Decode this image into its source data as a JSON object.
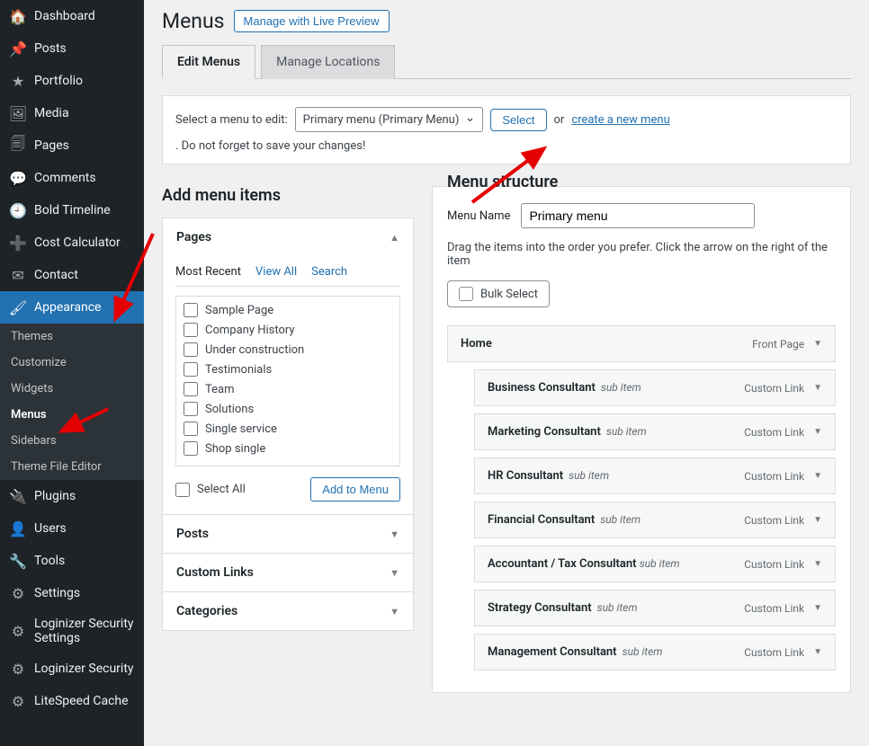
{
  "sidebar": {
    "items": [
      {
        "icon": "dashboard-icon",
        "glyph": "🏠",
        "label": "Dashboard"
      },
      {
        "icon": "posts-icon",
        "glyph": "📌",
        "label": "Posts"
      },
      {
        "icon": "portfolio-icon",
        "glyph": "★",
        "label": "Portfolio"
      },
      {
        "icon": "media-icon",
        "glyph": "🖼",
        "label": "Media"
      },
      {
        "icon": "pages-icon",
        "glyph": "🗐",
        "label": "Pages"
      },
      {
        "icon": "comments-icon",
        "glyph": "💬",
        "label": "Comments"
      },
      {
        "icon": "bold-timeline-icon",
        "glyph": "🕘",
        "label": "Bold Timeline"
      },
      {
        "icon": "cost-calculator-icon",
        "glyph": "➕",
        "label": "Cost Calculator"
      },
      {
        "icon": "contact-icon",
        "glyph": "✉",
        "label": "Contact"
      }
    ],
    "active": {
      "icon": "appearance-icon",
      "glyph": "🖌",
      "label": "Appearance"
    },
    "submenu": [
      "Themes",
      "Customize",
      "Widgets",
      "Menus",
      "Sidebars",
      "Theme File Editor"
    ],
    "submenu_current_index": 3,
    "items_after": [
      {
        "icon": "plugins-icon",
        "glyph": "🔌",
        "label": "Plugins"
      },
      {
        "icon": "users-icon",
        "glyph": "👤",
        "label": "Users"
      },
      {
        "icon": "tools-icon",
        "glyph": "🔧",
        "label": "Tools"
      },
      {
        "icon": "settings-icon",
        "glyph": "⚙",
        "label": "Settings"
      },
      {
        "icon": "loginizer-security-settings-icon",
        "glyph": "⚙",
        "label": "Loginizer Security Settings"
      },
      {
        "icon": "loginizer-security-icon",
        "glyph": "⚙",
        "label": "Loginizer Security"
      },
      {
        "icon": "litespeed-cache-icon",
        "glyph": "⚙",
        "label": "LiteSpeed Cache"
      }
    ]
  },
  "header": {
    "title": "Menus",
    "live_preview_button": "Manage with Live Preview"
  },
  "tabs": {
    "edit": "Edit Menus",
    "locations": "Manage Locations"
  },
  "select_bar": {
    "label": "Select a menu to edit:",
    "selected": "Primary menu (Primary Menu)",
    "select_button": "Select",
    "or": "or",
    "create_link": "create a new menu",
    "tail_text": ". Do not forget to save your changes!"
  },
  "add_panel": {
    "title": "Add menu items",
    "pages_heading": "Pages",
    "inner_tabs": {
      "most_recent": "Most Recent",
      "view_all": "View All",
      "search": "Search"
    },
    "pages": [
      "Sample Page",
      "Company History",
      "Under construction",
      "Testimonials",
      "Team",
      "Solutions",
      "Single service",
      "Shop single"
    ],
    "select_all": "Select All",
    "add_button": "Add to Menu",
    "collapsed": [
      "Posts",
      "Custom Links",
      "Categories"
    ]
  },
  "structure": {
    "title": "Menu structure",
    "name_label": "Menu Name",
    "name_value": "Primary menu",
    "hint": "Drag the items into the order you prefer. Click the arrow on the right of the item ",
    "bulk_select": "Bulk Select",
    "items": [
      {
        "title": "Home",
        "type": "Front Page",
        "level": 0
      },
      {
        "title": "Business Consultant",
        "type": "Custom Link",
        "sub": true,
        "level": 1
      },
      {
        "title": "Marketing Consultant",
        "type": "Custom Link",
        "sub": true,
        "level": 1
      },
      {
        "title": "HR Consultant",
        "type": "Custom Link",
        "sub": true,
        "level": 1
      },
      {
        "title": "Financial Consultant",
        "type": "Custom Link",
        "sub": true,
        "level": 1
      },
      {
        "title": "Accountant / Tax Consultant",
        "type": "Custom Link",
        "sub": true,
        "level": 1
      },
      {
        "title": "Strategy Consultant",
        "type": "Custom Link",
        "sub": true,
        "level": 1
      },
      {
        "title": "Management Consultant",
        "type": "Custom Link",
        "sub": true,
        "level": 1
      }
    ],
    "sub_label": "sub item"
  }
}
